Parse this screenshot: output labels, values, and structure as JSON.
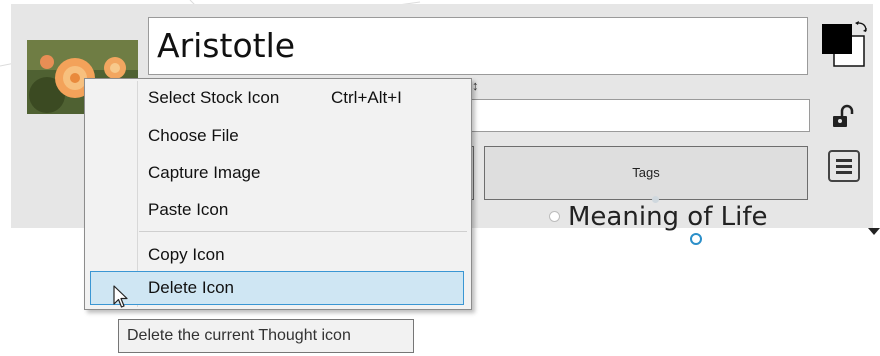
{
  "editor": {
    "thought_name": "Aristotle",
    "tags_label": "Tags",
    "background_label": "Meaning of Life"
  },
  "context_menu": {
    "items": [
      {
        "label": "Select Stock Icon",
        "shortcut": "Ctrl+Alt+I"
      },
      {
        "label": "Choose File",
        "shortcut": ""
      },
      {
        "label": "Capture Image",
        "shortcut": ""
      },
      {
        "label": "Paste Icon",
        "shortcut": ""
      },
      {
        "label": "Copy Icon",
        "shortcut": ""
      },
      {
        "label": "Delete Icon",
        "shortcut": ""
      }
    ],
    "highlighted_index": 5
  },
  "tooltip": {
    "text": "Delete the current Thought icon"
  },
  "icons": {
    "color": "color-swatch-icon",
    "lock": "unlock-icon",
    "menu": "hamburger-menu-icon",
    "resize": "resize-icon",
    "cursor": "mouse-pointer-icon",
    "caret": "dropdown-caret-icon"
  },
  "colors": {
    "highlight_fill": "#cfe6f3",
    "highlight_border": "#3a96d3",
    "link_circle": "#2b8fc9"
  }
}
